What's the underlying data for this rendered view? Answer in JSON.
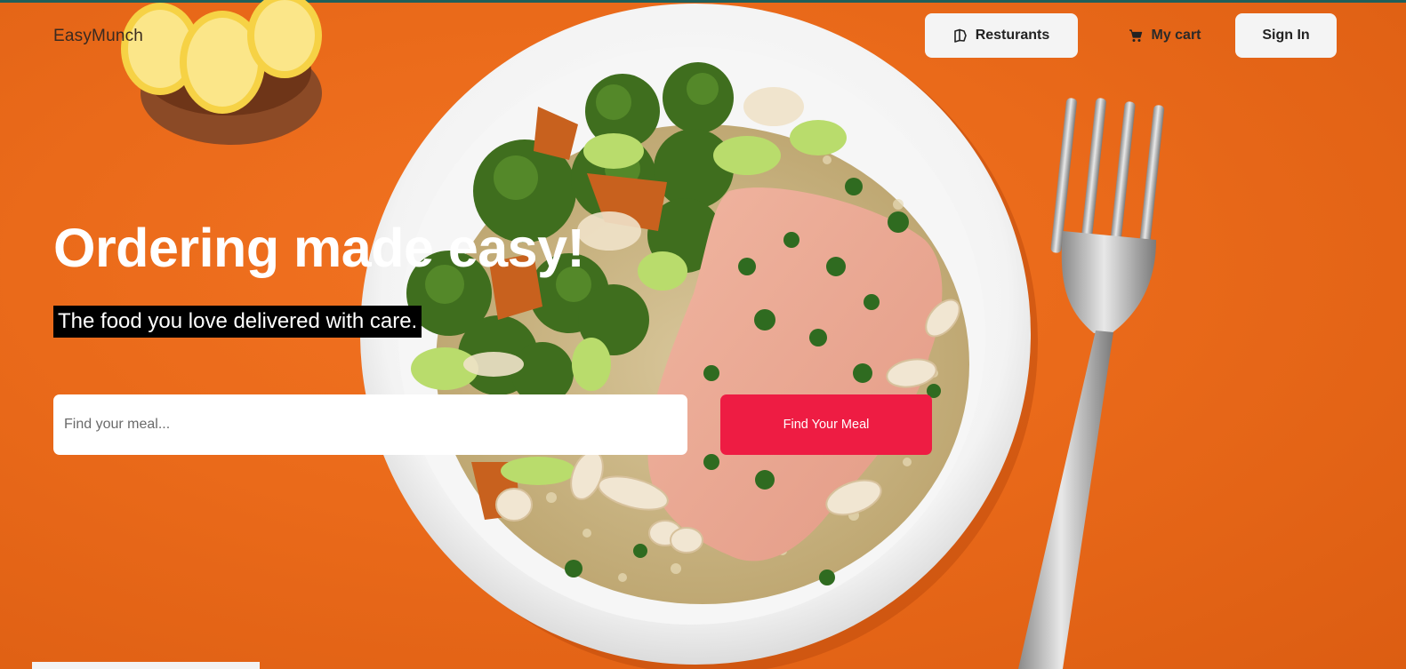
{
  "brand": {
    "name": "EasyMunch"
  },
  "nav": {
    "restaurants_label": "Resturants",
    "cart_label": "My cart",
    "signin_label": "Sign In"
  },
  "hero": {
    "headline": "Ordering made easy!",
    "subline": "The food you love delivered with care."
  },
  "search": {
    "placeholder": "Find your meal...",
    "value": "",
    "button_label": "Find Your Meal"
  },
  "icons": {
    "restaurants": "restaurant-menu-icon",
    "cart": "cart-icon"
  },
  "colors": {
    "background": "#ea6a1a",
    "accent": "#ee1c43",
    "headline_text": "#ffffff",
    "subline_bg": "#000000",
    "nav_button_bg": "#f4f4f4"
  }
}
